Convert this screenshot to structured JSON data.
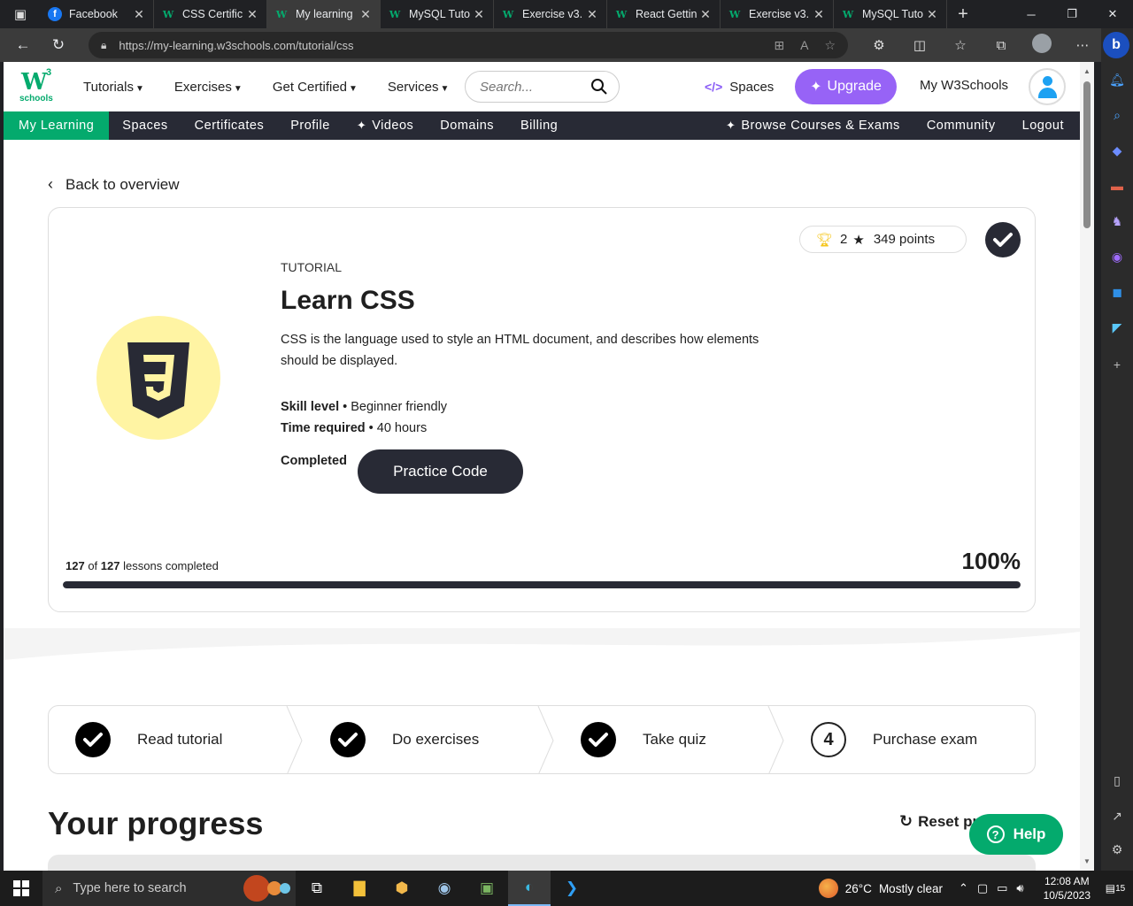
{
  "browser": {
    "tabs": [
      {
        "title": "Facebook",
        "icon": "facebook-icon",
        "active": false
      },
      {
        "title": "CSS Certific",
        "icon": "w3schools-icon",
        "active": false
      },
      {
        "title": "My learning",
        "icon": "w3schools-icon",
        "active": true
      },
      {
        "title": "MySQL Tuto",
        "icon": "w3schools-icon",
        "active": false
      },
      {
        "title": "Exercise v3.",
        "icon": "w3schools-icon",
        "active": false
      },
      {
        "title": "React Gettin",
        "icon": "w3schools-icon",
        "active": false
      },
      {
        "title": "Exercise v3.",
        "icon": "w3schools-icon",
        "active": false
      },
      {
        "title": "MySQL Tuto",
        "icon": "w3schools-icon",
        "active": false
      }
    ],
    "url": "https://my-learning.w3schools.com/tutorial/css"
  },
  "header": {
    "logo_text": "W",
    "logo_sup": "3",
    "logo_sub": "schools",
    "nav": [
      {
        "label": "Tutorials"
      },
      {
        "label": "Exercises"
      },
      {
        "label": "Get Certified"
      },
      {
        "label": "Services"
      }
    ],
    "search_placeholder": "Search...",
    "spaces_label": "Spaces",
    "upgrade_label": "Upgrade",
    "my_w3schools_label": "My W3Schools"
  },
  "subnav": {
    "left": [
      "My Learning",
      "Spaces",
      "Certificates",
      "Profile",
      "Videos",
      "Domains",
      "Billing"
    ],
    "right": [
      "Browse Courses & Exams",
      "Community",
      "Logout"
    ]
  },
  "content": {
    "back_label": "Back to overview",
    "tutorial_label": "TUTORIAL",
    "title": "Learn CSS",
    "description": "CSS is the language used to style an HTML document, and describes how elements should be displayed.",
    "skill_level_label": "Skill level",
    "skill_level_value": "• Beginner friendly",
    "time_required_label": "Time required",
    "time_required_value": "• 40 hours",
    "status_label": "Completed",
    "practice_button": "Practice Code",
    "trophies": "2",
    "points": "349 points",
    "lessons_done": "127",
    "lessons_of": "of",
    "lessons_total": "127",
    "lessons_suffix": "lessons completed",
    "percent": "100%",
    "progress_fraction": 1.0,
    "accent_color": "#04aa6d",
    "dark_color": "#282a35",
    "upgrade_color": "#9763f6",
    "css_badge_color": "#fff4a3"
  },
  "steps": [
    {
      "label": "Read tutorial",
      "done": true
    },
    {
      "label": "Do exercises",
      "done": true
    },
    {
      "label": "Take quiz",
      "done": true
    },
    {
      "label": "Purchase exam",
      "done": false,
      "number": "4"
    }
  ],
  "progress_section": {
    "title": "Your progress",
    "reset_label": "Reset pr",
    "help_label": "Help"
  },
  "taskbar": {
    "search_placeholder": "Type here to search",
    "weather_temp": "26°C",
    "weather_desc": "Mostly clear",
    "time": "12:08 AM",
    "date": "10/5/2023",
    "notifications": "15"
  }
}
